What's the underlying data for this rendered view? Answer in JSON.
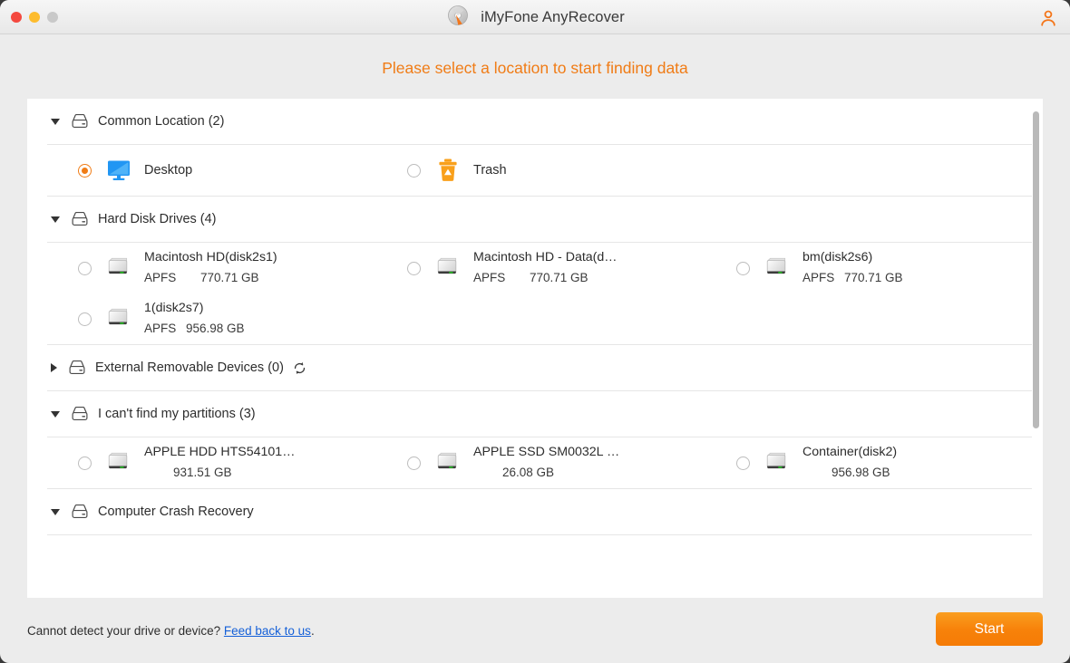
{
  "window": {
    "title": "iMyFone AnyRecover",
    "traffic_lights": [
      "close",
      "minimize",
      "zoom"
    ],
    "user_icon": "user-icon",
    "logo_icon": "disc-cursor-logo-icon"
  },
  "heading": "Please select a location to start finding data",
  "colors": {
    "accent": "#f07c16",
    "heading": "#f07c16",
    "link": "#1560d8",
    "selected_radio": "#f07c16",
    "drive_led": "#22c61f",
    "desktop_icon": "#2196f3",
    "trash_icon": "#f9a01b",
    "panel_bg": "#ffffff",
    "window_bg": "#ececec"
  },
  "sections": [
    {
      "id": "common-location",
      "title": "Common Location (2)",
      "expanded": true,
      "icon": "drive-outline-icon",
      "refresh": false,
      "items": [
        {
          "label": "Desktop",
          "icon": "monitor-icon",
          "selected": true,
          "fs": "",
          "size": ""
        },
        {
          "label": "Trash",
          "icon": "trash-icon",
          "selected": false,
          "fs": "",
          "size": ""
        }
      ]
    },
    {
      "id": "hard-disk-drives",
      "title": "Hard Disk Drives (4)",
      "expanded": true,
      "icon": "drive-outline-icon",
      "refresh": false,
      "items": [
        {
          "label": "Macintosh HD(disk2s1)",
          "icon": "hard-drive-icon",
          "selected": false,
          "fs": "APFS",
          "size": "770.71 GB"
        },
        {
          "label": "Macintosh HD - Data(d…",
          "icon": "hard-drive-icon",
          "selected": false,
          "fs": "APFS",
          "size": "770.71 GB"
        },
        {
          "label": "bm(disk2s6)",
          "icon": "hard-drive-icon",
          "selected": false,
          "fs": "APFS",
          "size": "770.71 GB"
        },
        {
          "label": "1(disk2s7)",
          "icon": "hard-drive-icon",
          "selected": false,
          "fs": "APFS",
          "size": "956.98 GB"
        }
      ]
    },
    {
      "id": "external-removable-devices",
      "title": "External Removable Devices (0)",
      "expanded": false,
      "icon": "drive-outline-icon",
      "refresh": true,
      "refresh_icon": "refresh-icon",
      "items": []
    },
    {
      "id": "cant-find-my-partitions",
      "title": "I can't find my partitions (3)",
      "expanded": true,
      "icon": "drive-outline-icon",
      "refresh": false,
      "items": [
        {
          "label": "APPLE HDD HTS54101…",
          "icon": "hard-drive-icon",
          "selected": false,
          "fs": "",
          "size": "931.51 GB"
        },
        {
          "label": "APPLE SSD SM0032L …",
          "icon": "hard-drive-icon",
          "selected": false,
          "fs": "",
          "size": "26.08 GB"
        },
        {
          "label": "Container(disk2)",
          "icon": "hard-drive-icon",
          "selected": false,
          "fs": "",
          "size": "956.98 GB"
        }
      ]
    },
    {
      "id": "computer-crash-recovery",
      "title": "Computer Crash Recovery",
      "expanded": true,
      "icon": "drive-outline-icon",
      "refresh": false,
      "items": []
    }
  ],
  "footer": {
    "text_before": "Cannot detect your drive or device? ",
    "link": "Feed back to us",
    "text_after": ".",
    "start_label": "Start"
  }
}
